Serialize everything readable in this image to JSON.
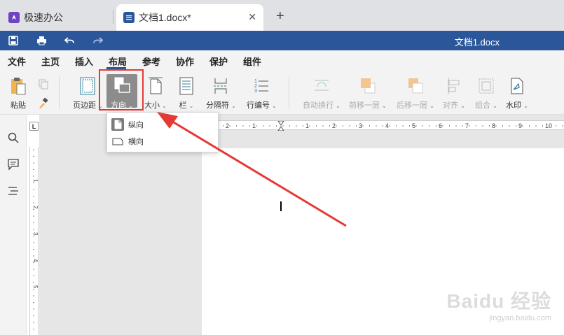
{
  "tabs": {
    "app": {
      "label": "极速办公",
      "icon": "rocket-icon"
    },
    "doc": {
      "label": "文档1.docx*",
      "icon": "document-icon"
    },
    "close": "✕",
    "new": "+"
  },
  "titlebar": {
    "title": "文档1.docx",
    "color": "#2b579a"
  },
  "menu": [
    "文件",
    "主页",
    "插入",
    "布局",
    "参考",
    "协作",
    "保护",
    "组件"
  ],
  "active_menu": "布局",
  "ribbon": {
    "paste": "粘贴",
    "margins": "页边距",
    "orientation": "方向",
    "size": "大小",
    "columns": "栏",
    "breaks": "分隔符",
    "line_numbers": "行编号",
    "wrap": "自动换行",
    "bring_forward": "前移一层",
    "send_backward": "后移一层",
    "align": "对齐",
    "group": "组合",
    "watermark": "水印"
  },
  "dropdown": {
    "portrait": "纵向",
    "landscape": "横向",
    "selected": "纵向"
  },
  "ruler": {
    "corner": "L",
    "labels": [
      "2",
      "1",
      "1",
      "2",
      "3",
      "4",
      "5",
      "6",
      "7",
      "8",
      "9",
      "10"
    ]
  },
  "vruler_labels": [
    "1",
    "2",
    "3",
    "4",
    "5"
  ],
  "watermark": {
    "brand": "Baidu 经验",
    "url": "jingyan.baidu.com"
  },
  "colors": {
    "accent": "#2b579a",
    "highlight": "#e53935"
  }
}
